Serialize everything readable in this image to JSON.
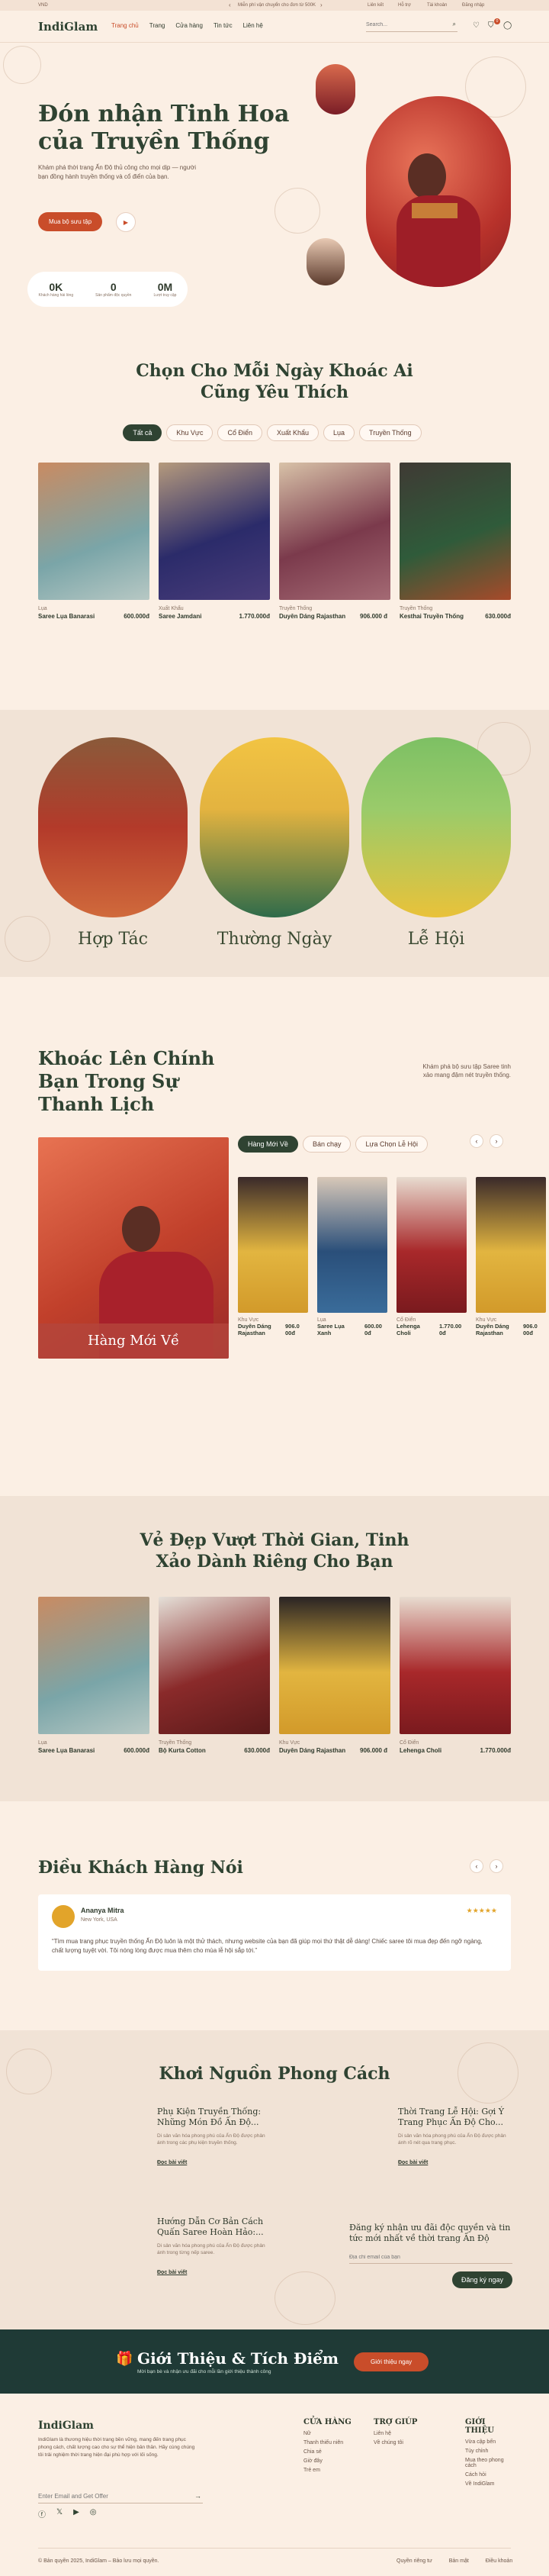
{
  "topbar": {
    "left": "VND",
    "promo": "Miễn phí vận chuyển cho đơn từ 500K",
    "links": [
      "Liên kết",
      "Hỗ trợ",
      "Tài khoản",
      "Đăng nhập"
    ]
  },
  "header": {
    "logo": "IndiGlam",
    "nav": [
      "Trang chủ",
      "Trang",
      "Cửa hàng",
      "Tin tức",
      "Liên hệ"
    ],
    "search_placeholder": "Search...",
    "cart_count": "0"
  },
  "hero": {
    "title_line1": "Đón nhận Tinh Hoa",
    "title_line2": "của Truyền Thống",
    "subtitle": "Khám phá thời trang Ấn Độ thủ công cho mọi dịp — người bạn đồng hành truyền thống và cổ điển của bạn.",
    "cta": "Mua bộ sưu tập",
    "stats": [
      {
        "value": "0K",
        "label": "Khách hàng hài lòng"
      },
      {
        "value": "0",
        "label": "Sản phẩm độc quyền"
      },
      {
        "value": "0M",
        "label": "Lượt truy cập"
      }
    ]
  },
  "choose": {
    "title_line1": "Chọn Cho Mỗi Ngày Khoác Ai",
    "title_line2": "Cũng Yêu Thích",
    "tabs": [
      "Tất cả",
      "Khu Vực",
      "Cổ Điển",
      "Xuất Khẩu",
      "Lụa",
      "Truyền Thống"
    ],
    "products": [
      {
        "cat": "Lụa",
        "name": "Saree Lụa Banarasi",
        "price": "600.000đ"
      },
      {
        "cat": "Xuất Khẩu",
        "name": "Saree Jamdani",
        "price": "1.770.000đ"
      },
      {
        "cat": "Truyền Thống",
        "name": "Duyên Dáng Rajasthan",
        "price": "906.000 đ"
      },
      {
        "cat": "Truyền Thống",
        "name": "Kesthai Truyền Thống",
        "price": "630.000đ"
      }
    ]
  },
  "occasions": [
    "Hợp Tác",
    "Thường Ngày",
    "Lễ Hội"
  ],
  "wear": {
    "title_line1": "Khoác Lên Chính",
    "title_line2": "Bạn Trong Sự",
    "title_line3": "Thanh Lịch",
    "desc": "Khám phá bộ sưu tập Saree tinh xảo mang đậm nét truyền thống.",
    "tabs": [
      "Hàng Mới Về",
      "Bán chạy",
      "Lựa Chọn Lễ Hội"
    ],
    "banner_label": "Hàng Mới Về",
    "products": [
      {
        "cat": "Khu Vực",
        "name": "Duyên Dáng Rajasthan",
        "price": "906.0 00đ"
      },
      {
        "cat": "Lụa",
        "name": "Saree Lụa Xanh",
        "price": "600.00 0đ"
      },
      {
        "cat": "Cổ Điển",
        "name": "Lehenga Choli",
        "price": "1.770.00 0đ"
      },
      {
        "cat": "Khu Vực",
        "name": "Duyên Dáng Rajasthan",
        "price": "906.0 00đ"
      }
    ]
  },
  "timeless": {
    "title_line1": "Vẻ Đẹp Vượt Thời Gian, Tinh",
    "title_line2": "Xảo Dành Riêng Cho Bạn",
    "products": [
      {
        "cat": "Lụa",
        "name": "Saree Lụa Banarasi",
        "price": "600.000đ"
      },
      {
        "cat": "Truyền Thống",
        "name": "Bộ Kurta Cotton",
        "price": "630.000đ"
      },
      {
        "cat": "Khu Vực",
        "name": "Duyên Dáng Rajasthan",
        "price": "906.000 đ"
      },
      {
        "cat": "Cổ Điển",
        "name": "Lehenga Choli",
        "price": "1.770.000đ"
      }
    ]
  },
  "testimonials": {
    "title": "Điều Khách Hàng Nói",
    "name": "Ananya Mitra",
    "location": "New York, USA",
    "stars": "★★★★★",
    "quote": "“Tìm mua trang phục truyền thống Ấn Độ luôn là một thử thách, nhưng website của bạn đã giúp mọi thứ thật dễ dàng! Chiếc saree tôi mua đẹp đến ngỡ ngàng, chất lượng tuyệt vời. Tôi nóng lòng được mua thêm cho mùa lễ hội sắp tới.”"
  },
  "blog": {
    "title": "Khơi Nguồn Phong Cách",
    "posts": [
      {
        "title": "Phụ Kiện Truyền Thống: Những Món Đồ Ấn Độ...",
        "excerpt": "Di sản văn hóa phong phú của Ấn Độ được phản ánh trong các phụ kiện truyền thống.",
        "link": "Đọc bài viết"
      },
      {
        "title": "Thời Trang Lễ Hội: Gợi Ý Trang Phục Ấn Độ Cho...",
        "excerpt": "Di sản văn hóa phong phú của Ấn Độ được phản ánh rõ nét qua trang phục.",
        "link": "Đọc bài viết"
      },
      {
        "title": "Hướng Dẫn Cơ Bản Cách Quấn Saree Hoàn Hảo:...",
        "excerpt": "Di sản văn hóa phong phú của Ấn Độ được phản ánh trong từng nếp saree.",
        "link": "Đọc bài viết"
      }
    ],
    "newsletter_title": "Đăng ký nhận ưu đãi độc quyền và tin tức mới nhất về thời trang Ấn Độ",
    "newsletter_placeholder": "Địa chỉ email của bạn",
    "newsletter_button": "Đăng ký ngay"
  },
  "rewards": {
    "title": "Giới Thiệu & Tích Điểm",
    "subtitle": "Mời bạn bè và nhận ưu đãi cho mỗi lần giới thiệu thành công",
    "button": "Giới thiệu ngay"
  },
  "footer": {
    "logo": "IndiGlam",
    "about": "IndiGlam là thương hiệu thời trang bền vững, mang đến trang phục phong cách, chất lượng cao cho sự thể hiện bản thân. Hãy cùng chúng tôi trải nghiệm thời trang hiện đại phù hợp với lối sống.",
    "email_placeholder": "Enter Email and Get Offer",
    "columns": [
      {
        "title": "CỬA HÀNG",
        "items": [
          "Nữ",
          "Thanh thiếu niên",
          "Chia sẻ",
          "Giờ đây",
          "Trẻ em"
        ]
      },
      {
        "title": "TRỢ GIÚP",
        "items": [
          "Liên hệ",
          "Về chúng tôi"
        ]
      },
      {
        "title": "GIỚI THIỆU",
        "items": [
          "Vừa cập bến",
          "Tùy chỉnh",
          "Mua theo phong cách",
          "Cách hỏi",
          "Về IndiGlam"
        ]
      }
    ],
    "copyright": "© Bản quyền 2025, IndiGlam – Bảo lưu mọi quyền.",
    "bottom_links": [
      "Quyền riêng tư",
      "Bản mật",
      "Điều khoản"
    ]
  },
  "colors": {
    "accent": "#c94d2a",
    "dark": "#2f4332",
    "cream": "#fbefe4"
  }
}
